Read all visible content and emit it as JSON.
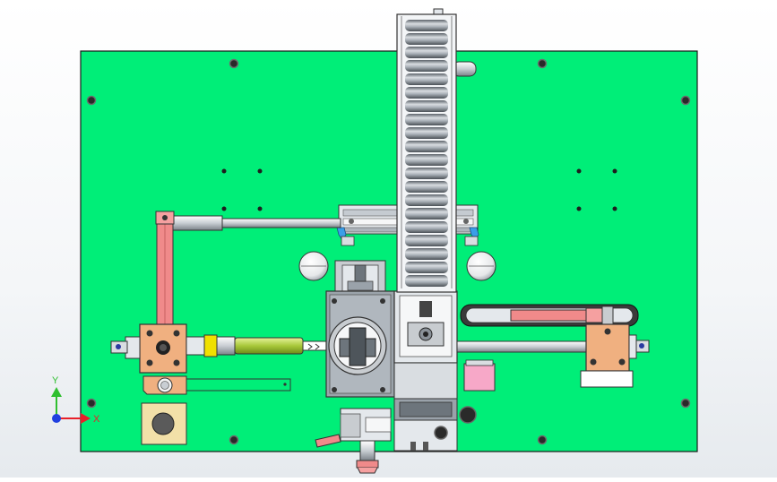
{
  "viewport": {
    "background": "#f2f4f6",
    "plate_color": "#00ee78",
    "edge_color": "#1a1a1a"
  },
  "triad": {
    "x_label": "X",
    "y_label": "Y",
    "x_color": "#e8202a",
    "y_color": "#2fbf2f",
    "z_color": "#2040e0"
  },
  "colors": {
    "metal": "#e4e8ec",
    "metal_dark": "#9aa2aa",
    "copper": "#f0b080",
    "salmon": "#f08a8a",
    "olive": "#a8c83a",
    "yellow": "#f0e000",
    "pink": "#f7a8c8",
    "blue": "#3a9ee8",
    "tan": "#f2e0a8"
  }
}
